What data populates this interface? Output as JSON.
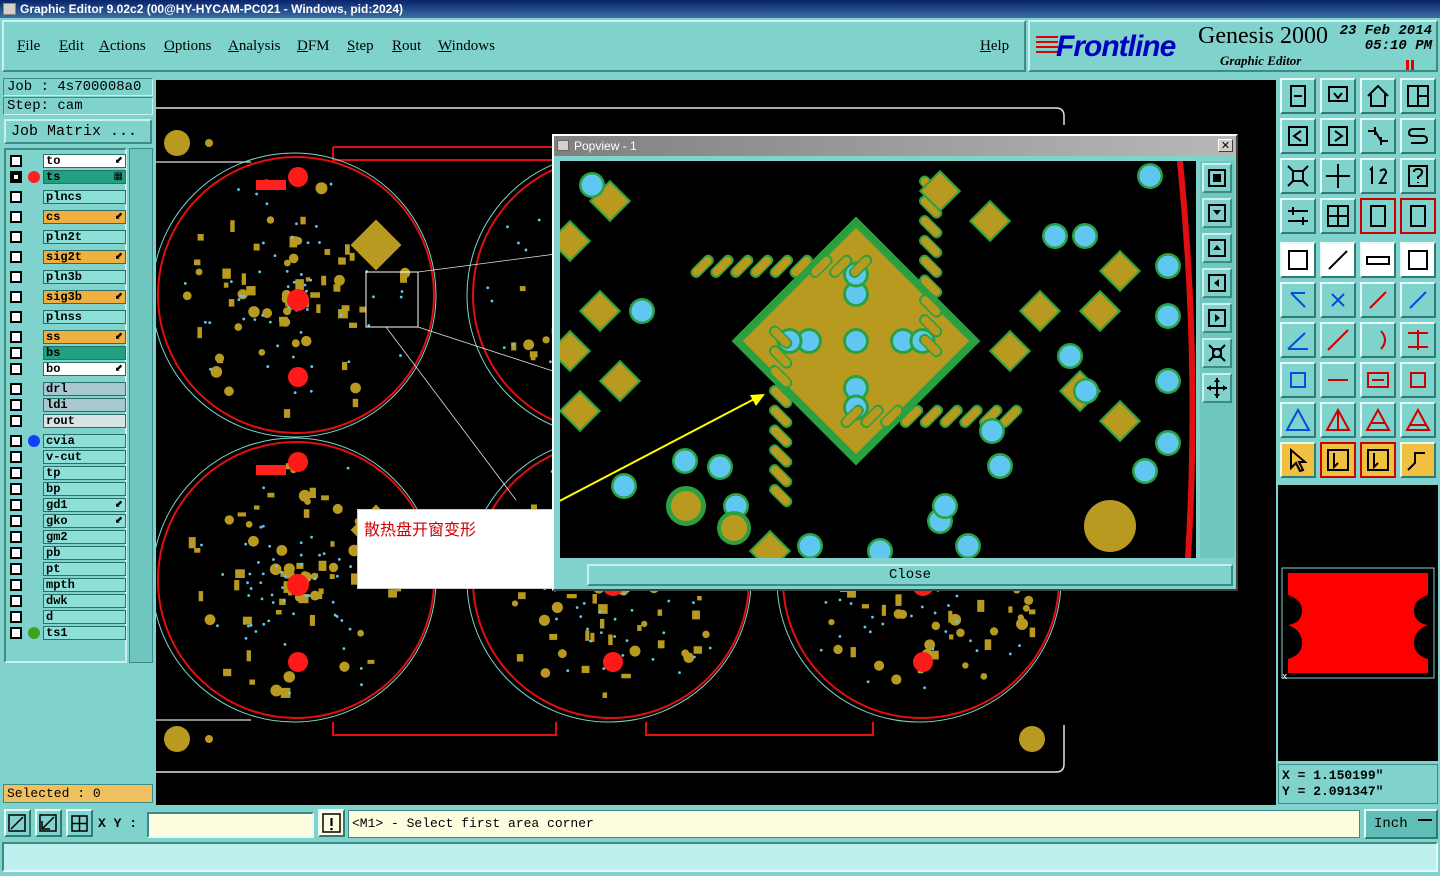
{
  "window": {
    "title": "Graphic Editor 9.02c2 (00@HY-HYCAM-PC021 - Windows, pid:2024)",
    "buttons": [
      "_",
      "❐",
      "✕"
    ]
  },
  "menu": [
    "File",
    "Edit",
    "Actions",
    "Options",
    "Analysis",
    "DFM",
    "Step",
    "Rout",
    "Windows"
  ],
  "help_label": "Help",
  "logo": {
    "brand": "Frontline",
    "product": "Genesis 2000",
    "subtitle": "Graphic Editor",
    "date": "23 Feb 2014",
    "time": "05:10 PM"
  },
  "job": {
    "job_line": "Job : 4s700008a0",
    "step_line": "Step: cam",
    "matrix_button": "Job Matrix ..."
  },
  "layers": [
    {
      "name": "to",
      "bg": "#ffffff",
      "dot": "",
      "mark": "⬋",
      "checked": false
    },
    {
      "name": "ts",
      "bg": "#20a080",
      "dot": "#ff2020",
      "mark": "▦",
      "checked": true
    },
    {
      "name": "plncs",
      "bg": "#8ce0d8",
      "dot": "",
      "mark": "",
      "checked": false,
      "gap": true
    },
    {
      "name": "cs",
      "bg": "#f0b040",
      "dot": "",
      "mark": "⬋",
      "checked": false,
      "gap": true
    },
    {
      "name": "pln2t",
      "bg": "#8ce0d8",
      "dot": "",
      "mark": "",
      "checked": false,
      "gap": true
    },
    {
      "name": "sig2t",
      "bg": "#f0b040",
      "dot": "",
      "mark": "⬋",
      "checked": false,
      "gap": true
    },
    {
      "name": "pln3b",
      "bg": "#8ce0d8",
      "dot": "",
      "mark": "",
      "checked": false,
      "gap": true
    },
    {
      "name": "sig3b",
      "bg": "#f0b040",
      "dot": "",
      "mark": "⬋",
      "checked": false,
      "gap": true
    },
    {
      "name": "plnss",
      "bg": "#8ce0d8",
      "dot": "",
      "mark": "",
      "checked": false,
      "gap": true
    },
    {
      "name": "ss",
      "bg": "#f0b040",
      "dot": "",
      "mark": "⬋",
      "checked": false,
      "gap": true
    },
    {
      "name": "bs",
      "bg": "#20a080",
      "dot": "",
      "mark": "",
      "checked": false
    },
    {
      "name": "bo",
      "bg": "#ffffff",
      "dot": "",
      "mark": "⬋",
      "checked": false
    },
    {
      "name": "drl",
      "bg": "#a8c8d0",
      "dot": "",
      "mark": "",
      "checked": false,
      "gap": true
    },
    {
      "name": "ldi",
      "bg": "#a8c8d0",
      "dot": "",
      "mark": "",
      "checked": false
    },
    {
      "name": "rout",
      "bg": "#d8e4e4",
      "dot": "",
      "mark": "",
      "checked": false
    },
    {
      "name": "cvia",
      "bg": "#8ce0d8",
      "dot": "#1040ff",
      "mark": "",
      "checked": false,
      "gap": true
    },
    {
      "name": "v-cut",
      "bg": "#8ce0d8",
      "dot": "",
      "mark": "",
      "checked": false
    },
    {
      "name": "tp",
      "bg": "#8ce0d8",
      "dot": "",
      "mark": "",
      "checked": false
    },
    {
      "name": "bp",
      "bg": "#8ce0d8",
      "dot": "",
      "mark": "",
      "checked": false
    },
    {
      "name": "gd1",
      "bg": "#8ce0d8",
      "dot": "",
      "mark": "⬋",
      "checked": false
    },
    {
      "name": "gko",
      "bg": "#8ce0d8",
      "dot": "",
      "mark": "⬋",
      "checked": false
    },
    {
      "name": "gm2",
      "bg": "#8ce0d8",
      "dot": "",
      "mark": "",
      "checked": false
    },
    {
      "name": "pb",
      "bg": "#8ce0d8",
      "dot": "",
      "mark": "",
      "checked": false
    },
    {
      "name": "pt",
      "bg": "#8ce0d8",
      "dot": "",
      "mark": "",
      "checked": false
    },
    {
      "name": "mpth",
      "bg": "#8ce0d8",
      "dot": "",
      "mark": "",
      "checked": false
    },
    {
      "name": "dwk",
      "bg": "#8ce0d8",
      "dot": "",
      "mark": "",
      "checked": false
    },
    {
      "name": "d",
      "bg": "#8ce0d8",
      "dot": "",
      "mark": "",
      "checked": false
    },
    {
      "name": "ts1",
      "bg": "#8ce0d8",
      "dot": "#40a020",
      "mark": "",
      "checked": false
    }
  ],
  "selected_text": "Selected : 0",
  "popview": {
    "title": "Popview - 1",
    "close_label": "Close"
  },
  "annotation": "散热盘开窗变形",
  "coords": {
    "x_line": "X = 1.150199\"",
    "y_line": "Y = 2.091347\""
  },
  "bottom": {
    "xy_label": "X Y :",
    "xy_value": "",
    "message": "<M1> - Select first area corner",
    "unit": "Inch"
  },
  "colors": {
    "panel": "#7fd3cc",
    "copper": "#b8a020",
    "soldermask": "#2aa040",
    "outline": "#e01010",
    "via": "#60c8f0"
  }
}
